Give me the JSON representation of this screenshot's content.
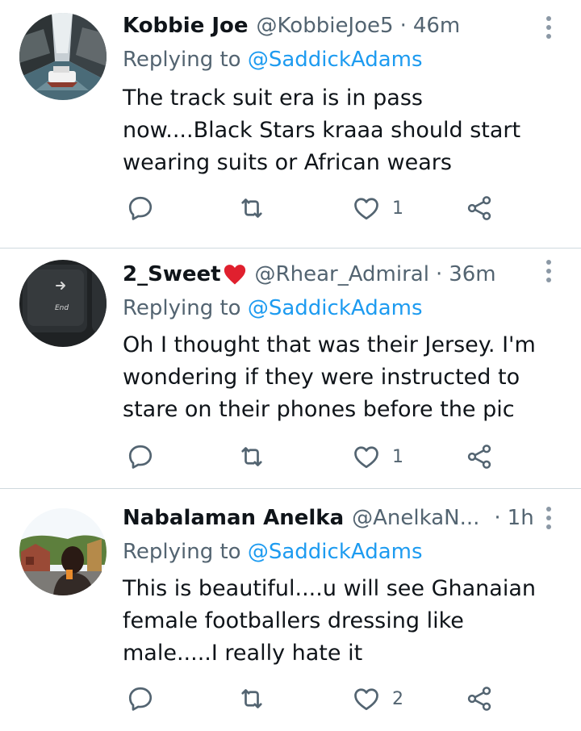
{
  "tweets": [
    {
      "name": "Kobbie Joe",
      "has_heart_emoji": false,
      "handle": "@KobbieJoe5",
      "separator": "·",
      "time": "46m",
      "replying_prefix": "Replying to",
      "replying_to": "@SaddickAdams",
      "text": "The track suit era is in pass\nnow....Black Stars kraaa should start\nwearing suits or African wears",
      "like_count": "1",
      "avatar_icon": "boat-on-river-photo"
    },
    {
      "name": "2_Sweet",
      "has_heart_emoji": true,
      "handle": "@Rhear_Admiral",
      "separator": "·",
      "time": "36m",
      "replying_prefix": "Replying to",
      "replying_to": "@SaddickAdams",
      "text": "Oh I thought that was their Jersey. I'm\nwondering if  they were instructed to\nstare on their phones before the pic",
      "like_count": "1",
      "avatar_icon": "keyboard-end-key-photo",
      "avatar_key_label": "End"
    },
    {
      "name": "Nabalaman Anelka",
      "has_heart_emoji": false,
      "handle": "@AnelkaN...",
      "separator": "·",
      "time": "1h",
      "replying_prefix": "Replying to",
      "replying_to": "@SaddickAdams",
      "text": "This is beautiful....u will see Ghanaian\nfemale footballers dressing like\nmale.....I really hate it",
      "like_count": "2",
      "avatar_icon": "person-outdoor-photo"
    }
  ],
  "icons": {
    "reply": "reply-icon",
    "retweet": "retweet-icon",
    "like": "heart-icon",
    "share": "share-icon",
    "more": "more-vertical-icon"
  },
  "colors": {
    "text": "#0f1419",
    "secondary": "#536471",
    "link": "#1d9bf0",
    "divider": "#cfd9de",
    "heart_emoji": "#e0202e"
  }
}
